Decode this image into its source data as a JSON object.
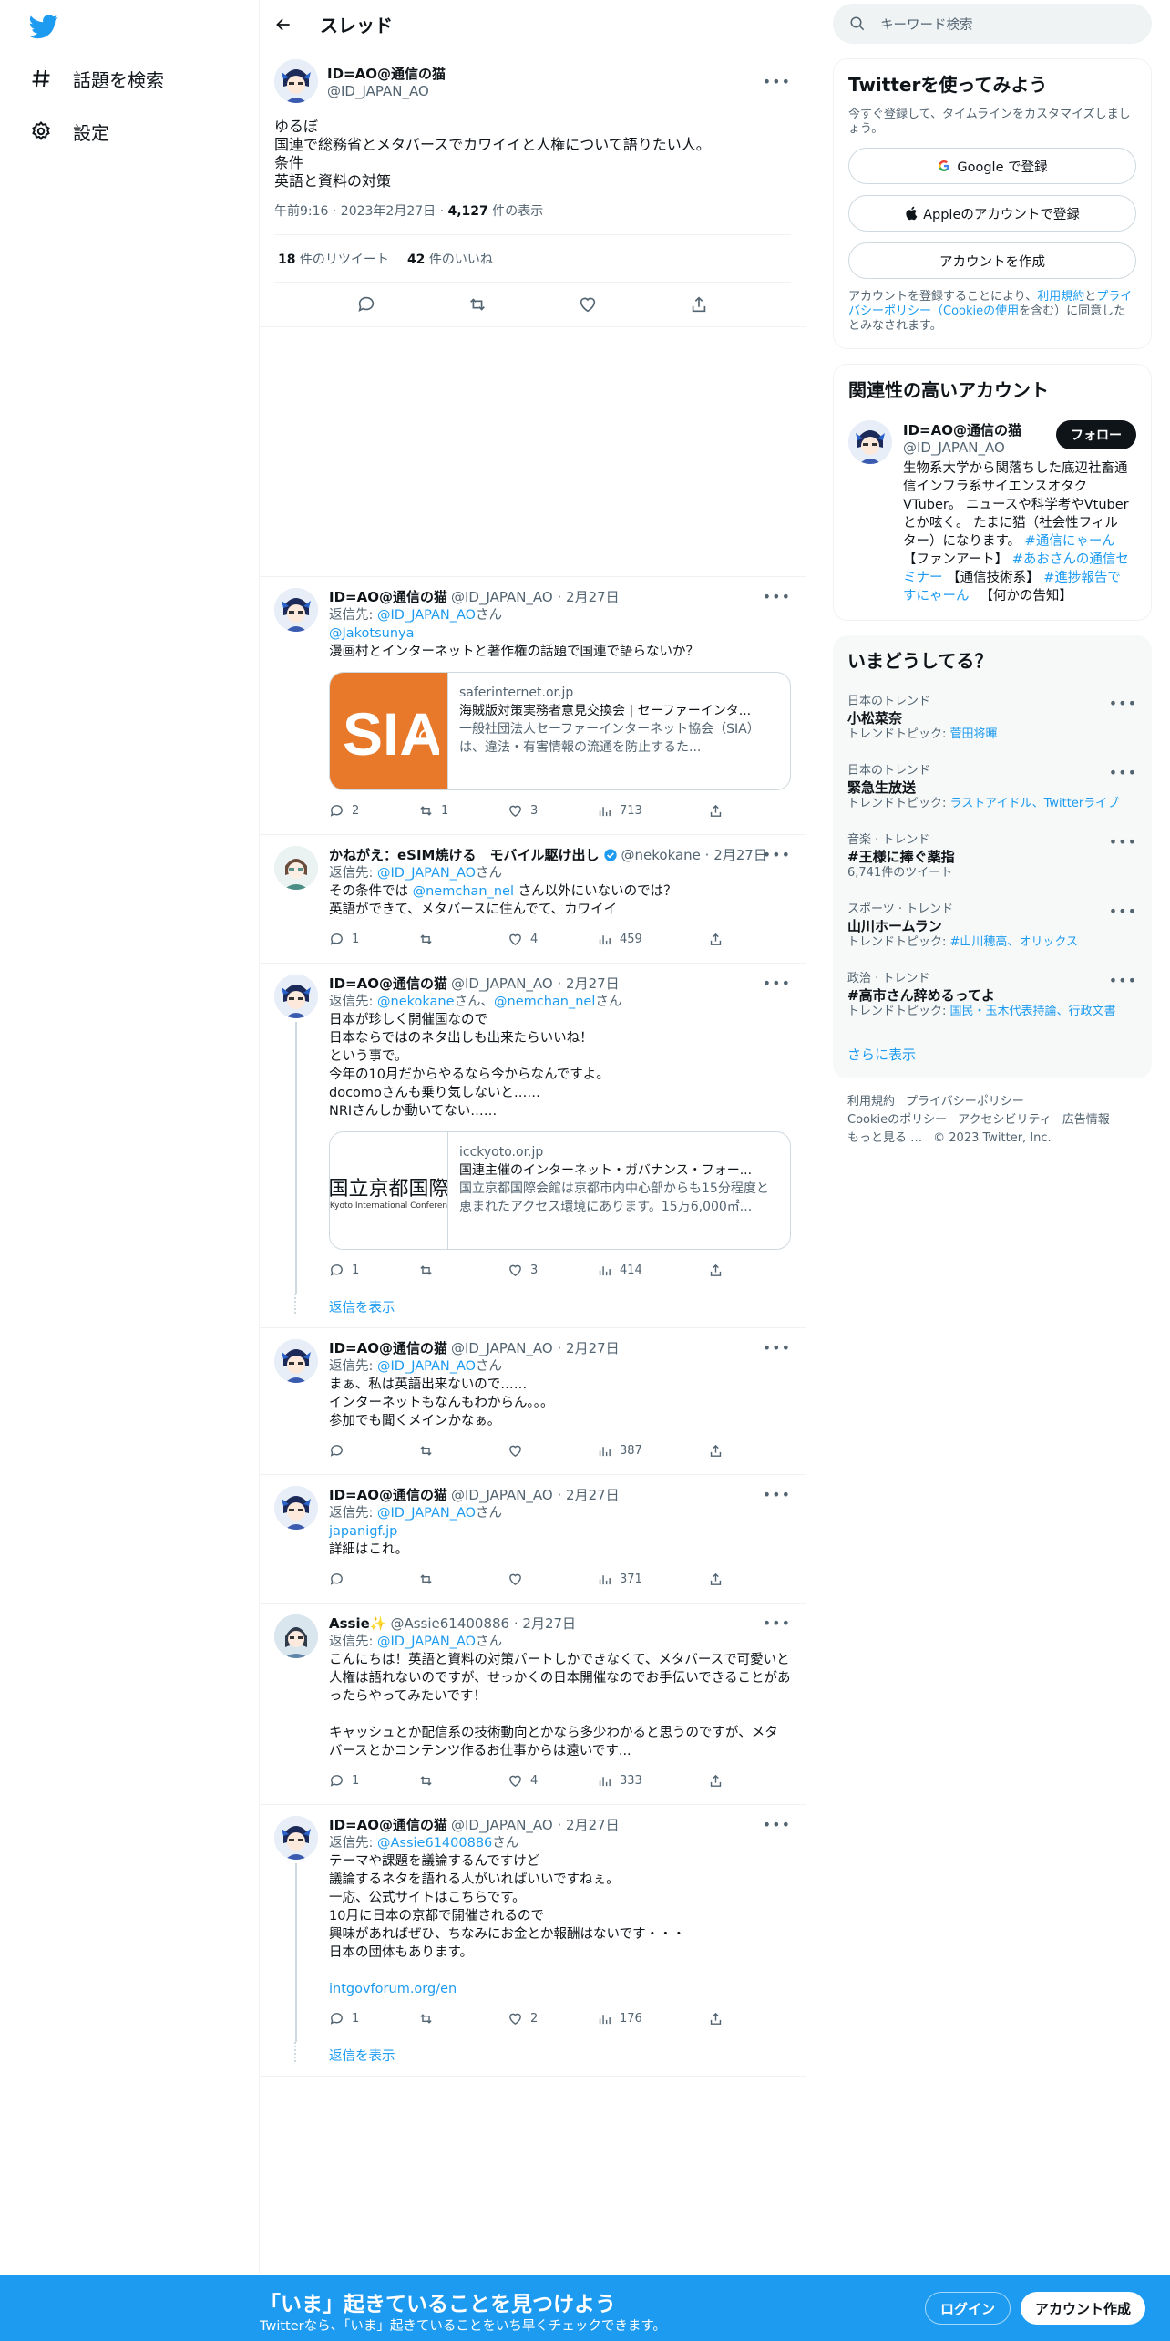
{
  "nav": {
    "explore_label": "話題を検索",
    "settings_label": "設定"
  },
  "header": {
    "title": "スレッド"
  },
  "focus": {
    "name": "ID=AO@通信の猫",
    "handle": "@ID_JAPAN_AO",
    "lines": [
      "ゆるぼ",
      "国連で総務省とメタバースでカワイイと人権について語りたい人。",
      "条件",
      "英語と資料の対策"
    ],
    "time": "午前9:16 · 2023年2月27日 · ",
    "views": "4,127",
    "views_suffix": " 件の表示",
    "retweets": "18",
    "retweets_label": " 件のリツイート",
    "likes": "42",
    "likes_label": " 件のいいね"
  },
  "tweets": [
    {
      "name": "ID=AO@通信の猫",
      "handle": "@ID_JAPAN_AO · 2月27日",
      "reply_prefix": "返信先: ",
      "reply_link": "@ID_JAPAN_AO",
      "reply_suffix": "さん",
      "lines": [
        "@Jakotsunya",
        "漫画村とインターネットと著作権の話題で国連で語らないか？"
      ],
      "card": {
        "domain": "saferinternet.or.jp",
        "title": "海賊版対策実務者意見交換会 | セーファーインタ...",
        "desc": "一般社団法人セーファーインターネット協会（SIA）は、違法・有害情報の流通を防止するた..."
      },
      "replies": "2",
      "retweets": "1",
      "likes": "3",
      "views": "713"
    },
    {
      "name": "かねがえ：eSIM焼ける　モバイル駆け出し",
      "handle": "@nekokane · 2月27日",
      "reply_prefix": "返信先: ",
      "reply_link": "@ID_JAPAN_AO",
      "reply_suffix": "さん",
      "lines": [
        "その条件では @nemchan_nel さん以外にいないのでは？",
        "英語ができて、メタバースに住んでて、カワイイ"
      ],
      "replies": "1",
      "retweets": "",
      "likes": "4",
      "views": "459"
    },
    {
      "name": "ID=AO@通信の猫",
      "handle": "@ID_JAPAN_AO · 2月27日",
      "reply_prefix": "返信先: ",
      "reply_link": "@nekokane",
      "reply_mid": "さん、",
      "reply_link2": "@nemchan_nel",
      "reply_suffix": "さん",
      "lines": [
        "日本が珍しく開催国なので",
        "日本ならではのネタ出しも出来たらいいね！",
        "という事で。",
        "今年の10月だからやるなら今からなんですよ。",
        "docomoさんも乗り気しないと……",
        "NRIさんしか動いてない……"
      ],
      "card": {
        "img_text": "国立京都国際",
        "img_sub": "Kyoto International Conferen",
        "domain": "icckyoto.or.jp",
        "title": "国連主催のインターネット・ガバナンス・フォー...",
        "desc": "国立京都国際会館は京都市内中心部からも15分程度と恵まれたアクセス環境にあります。15万6,000㎡..."
      },
      "replies": "1",
      "retweets": "",
      "likes": "3",
      "views": "414"
    },
    {
      "name": "ID=AO@通信の猫",
      "handle": "@ID_JAPAN_AO · 2月27日",
      "reply_prefix": "返信先: ",
      "reply_link": "@ID_JAPAN_AO",
      "reply_suffix": "さん",
      "lines": [
        "まぁ、私は英語出来ないので……",
        "インターネットもなんもわからん。。。",
        "参加でも聞くメインかなぁ。"
      ],
      "replies": "",
      "retweets": "",
      "likes": "",
      "views": "387"
    },
    {
      "name": "ID=AO@通信の猫",
      "handle": "@ID_JAPAN_AO · 2月27日",
      "reply_prefix": "返信先: ",
      "reply_link": "@ID_JAPAN_AO",
      "reply_suffix": "さん",
      "link_line": "japanigf.jp",
      "lines": [
        "詳細はこれ。"
      ],
      "replies": "",
      "retweets": "",
      "likes": "",
      "views": "371"
    },
    {
      "name": "Assie✨",
      "handle": "@Assie61400886 · 2月27日",
      "reply_prefix": "返信先: ",
      "reply_link": "@ID_JAPAN_AO",
      "reply_suffix": "さん",
      "lines": [
        "こんにちは！英語と資料の対策パートしかできなくて、メタバースで可愛いと人権は語れないのですが、せっかくの日本開催なのでお手伝いできることがあったらやってみたいです！",
        "",
        "キャッシュとか配信系の技術動向とかなら多少わかると思うのですが、メタバースとかコンテンツ作るお仕事からは遠いです..."
      ],
      "replies": "1",
      "retweets": "",
      "likes": "4",
      "views": "333"
    },
    {
      "name": "ID=AO@通信の猫",
      "handle": "@ID_JAPAN_AO · 2月27日",
      "reply_prefix": "返信先: ",
      "reply_link": "@Assie61400886",
      "reply_suffix": "さん",
      "lines": [
        "テーマや課題を議論するんですけど",
        "議論するネタを語れる人がいればいいですねぇ。",
        "一応、公式サイトはこちらです。",
        "10月に日本の京都で開催されるので",
        "興味があればぜひ、ちなみにお金とか報酬はないです・・・",
        "日本の団体もあります。",
        ""
      ],
      "link_line_after": "intgovforum.org/en",
      "replies": "1",
      "retweets": "",
      "likes": "2",
      "views": "176"
    }
  ],
  "show_replies": "返信を表示",
  "search": {
    "placeholder": "キーワード検索"
  },
  "signup": {
    "title": "Twitterを使ってみよう",
    "sub": "今すぐ登録して、タイムラインをカスタマイズしましょう。",
    "google": "Google で登録",
    "apple": "Appleのアカウントで登録",
    "create": "アカウントを作成",
    "terms_a": "アカウントを登録することにより、",
    "terms_link1": "利用規約",
    "terms_b": "と",
    "terms_link2": "プライバシーポリシー（Cookieの使用",
    "terms_c": "を含む）に同意したとみなされます。"
  },
  "related": {
    "title": "関連性の高いアカウント",
    "name": "ID=AO@通信の猫",
    "handle": "@ID_JAPAN_AO",
    "follow": "フォロー",
    "bio_a": "生物系大学から関落ちした底辺社畜通信インフラ系サイエンスオタクVTuber。 ニュースや科学考やVtuberとか呟く。 たまに猫（社会性フィルター）になります。",
    "bio_tag1": "#通信にゃーん",
    "bio_b": "【ファンアート】",
    "bio_tag2": "#あおさんの通信セミナー",
    "bio_c": "【通信技術系】",
    "bio_tag3": "#進捗報告ですにゃーん",
    "bio_d": "【何かの告知】"
  },
  "trends": {
    "title": "いまどうしてる？",
    "items": [
      {
        "category": "日本のトレンド",
        "name": "小松菜奈",
        "topic_prefix": "トレンドトピック: ",
        "topic": "菅田将暉"
      },
      {
        "category": "日本のトレンド",
        "name": "緊急生放送",
        "topic_prefix": "トレンドトピック: ",
        "topic": "ラストアイドル、Twitterライブ"
      },
      {
        "category": "音楽 · トレンド",
        "name": "#王様に捧ぐ薬指",
        "topic_prefix": "",
        "topic": "",
        "count": "6,741件のツイート"
      },
      {
        "category": "スポーツ · トレンド",
        "name": "山川ホームラン",
        "topic_prefix": "トレンドトピック: ",
        "topic": "#山川穂高、オリックス"
      },
      {
        "category": "政治 · トレンド",
        "name": "#高市さん辞めるってよ",
        "topic_prefix": "トレンドトピック: ",
        "topic": "国民・玉木代表持論、行政文書"
      }
    ],
    "more": "さらに表示"
  },
  "footer": {
    "l1": "利用規約",
    "l2": "プライバシーポリシー",
    "l3": "Cookieのポリシー",
    "l4": "アクセシビリティ",
    "l5": "広告情報",
    "l6": "もっと見る …",
    "copy": "© 2023 Twitter, Inc."
  },
  "bottom": {
    "title": "「いま」起きていることを見つけよう",
    "sub": "Twitterなら、「いま」起きていることをいち早くチェックできます。",
    "login": "ログイン",
    "signup": "アカウント作成"
  },
  "colors": {
    "accent": "#1d9bf0",
    "text": "#0f1419",
    "muted": "#536471"
  }
}
